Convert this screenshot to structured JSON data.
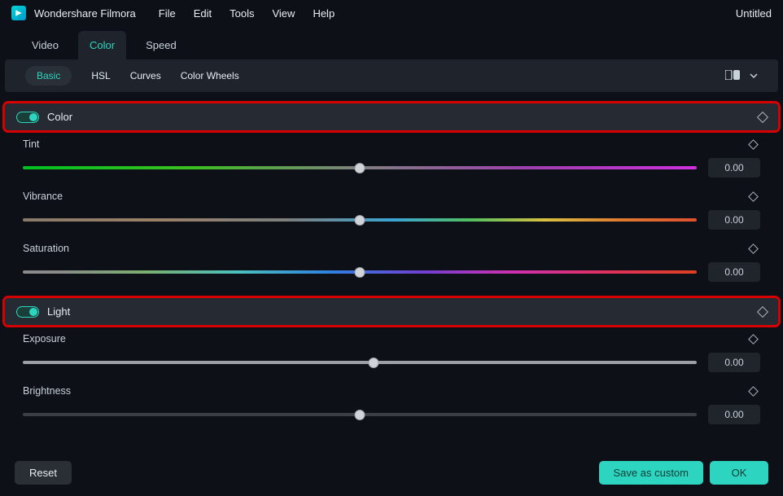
{
  "app": {
    "name": "Wondershare Filmora"
  },
  "menu": {
    "file": "File",
    "edit": "Edit",
    "tools": "Tools",
    "view": "View",
    "help": "Help"
  },
  "doc": {
    "title": "Untitled"
  },
  "panelTabs": {
    "video": "Video",
    "color": "Color",
    "speed": "Speed"
  },
  "subTabs": {
    "basic": "Basic",
    "hsl": "HSL",
    "curves": "Curves",
    "wheels": "Color Wheels"
  },
  "sections": {
    "color": {
      "title": "Color"
    },
    "light": {
      "title": "Light"
    }
  },
  "params": {
    "tint": {
      "label": "Tint",
      "value": "0.00"
    },
    "vibrance": {
      "label": "Vibrance",
      "value": "0.00"
    },
    "saturation": {
      "label": "Saturation",
      "value": "0.00"
    },
    "exposure": {
      "label": "Exposure",
      "value": "0.00"
    },
    "brightness": {
      "label": "Brightness",
      "value": "0.00"
    }
  },
  "footer": {
    "reset": "Reset",
    "save": "Save as custom",
    "ok": "OK"
  }
}
